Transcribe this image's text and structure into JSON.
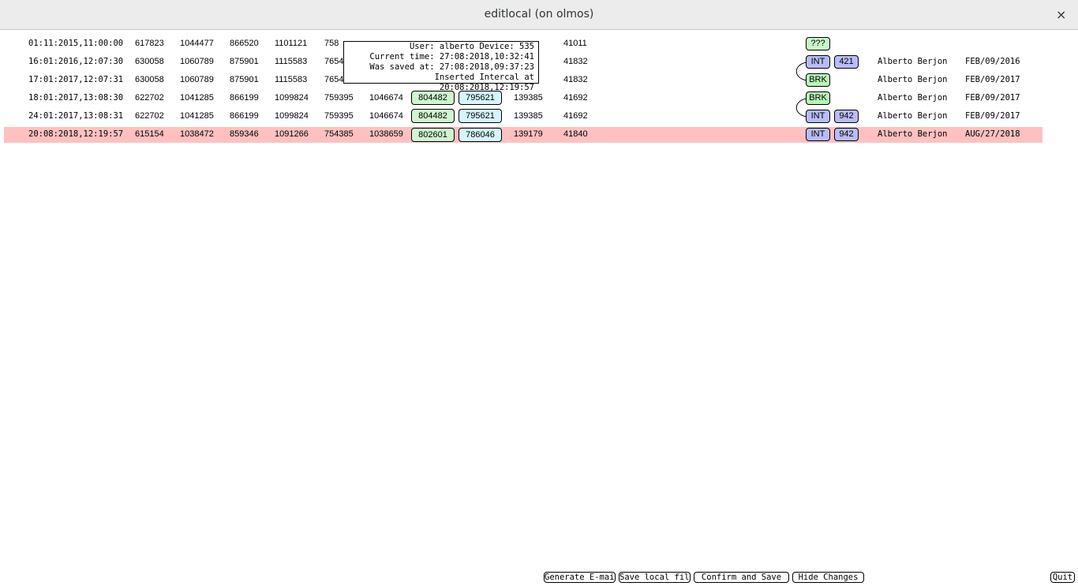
{
  "window": {
    "title": "editlocal (on olmos)",
    "close_symbol": "×"
  },
  "columns": [
    "datetime",
    "c1",
    "c2",
    "c3",
    "c4",
    "c5",
    "c6",
    "green_value",
    "cyan_value",
    "c9",
    "c10"
  ],
  "rows": [
    {
      "datetime": "01:11:2015,11:00:00",
      "c1": "617823",
      "c2": "1044477",
      "c3": "866520",
      "c4": "1101121",
      "c5": "758",
      "c6": "",
      "green": "",
      "cyan": "",
      "c9": "",
      "c10": "41011",
      "tag": "???",
      "tag_num": "",
      "user": "",
      "date": ""
    },
    {
      "datetime": "16:01:2016,12:07:30",
      "c1": "630058",
      "c2": "1060789",
      "c3": "875901",
      "c4": "1115583",
      "c5": "7654",
      "c6": "",
      "green": "",
      "cyan": "",
      "c9": "",
      "c10": "41832",
      "tag": "INT",
      "tag_num": "421",
      "user": "Alberto Berjon",
      "date": "FEB/09/2016"
    },
    {
      "datetime": "17:01:2017,12:07:31",
      "c1": "630058",
      "c2": "1060789",
      "c3": "875901",
      "c4": "1115583",
      "c5": "7654",
      "c6": "",
      "green": "",
      "cyan": "",
      "c9": "",
      "c10": "41832",
      "tag": "BRK",
      "tag_num": "",
      "user": "Alberto Berjon",
      "date": "FEB/09/2017"
    },
    {
      "datetime": "18:01:2017,13:08:30",
      "c1": "622702",
      "c2": "1041285",
      "c3": "866199",
      "c4": "1099824",
      "c5": "759395",
      "c6": "1046674",
      "green": "804482",
      "cyan": "795621",
      "c9": "139385",
      "c10": "41692",
      "tag": "BRK",
      "tag_num": "",
      "user": "Alberto Berjon",
      "date": "FEB/09/2017"
    },
    {
      "datetime": "24:01:2017,13:08:31",
      "c1": "622702",
      "c2": "1041285",
      "c3": "866199",
      "c4": "1099824",
      "c5": "759395",
      "c6": "1046674",
      "green": "804482",
      "cyan": "795621",
      "c9": "139385",
      "c10": "41692",
      "tag": "INT",
      "tag_num": "942",
      "user": "Alberto Berjon",
      "date": "FEB/09/2017"
    },
    {
      "datetime": "20:08:2018,12:19:57",
      "c1": "615154",
      "c2": "1038472",
      "c3": "859346",
      "c4": "1091266",
      "c5": "754385",
      "c6": "1038659",
      "green": "802601",
      "cyan": "786046",
      "c9": "139179",
      "c10": "41840",
      "tag": "INT",
      "tag_num": "942",
      "user": "Alberto Berjon",
      "date": "AUG/27/2018"
    }
  ],
  "tooltip": {
    "line1": "User: alberto Device: 535",
    "line2": "Current time: 27:08:2018,10:32:41",
    "line3": "Was saved at: 27:08:2018,09:37:23",
    "line4": "Inserted Intercal at 20:08:2018,12:19:57"
  },
  "buttons": {
    "generate_email": "Generate E-mail",
    "save_local": "Save local file",
    "confirm_save": "Confirm and Save",
    "hide_changes": "Hide Changes",
    "quit": "Quit"
  },
  "colors": {
    "highlight_row": "#ffc0c0",
    "green_box": "#cff5cf",
    "cyan_box": "#d6f6ff",
    "int_tag": "#b8bcf6",
    "brk_tag": "#b9f5b9"
  }
}
